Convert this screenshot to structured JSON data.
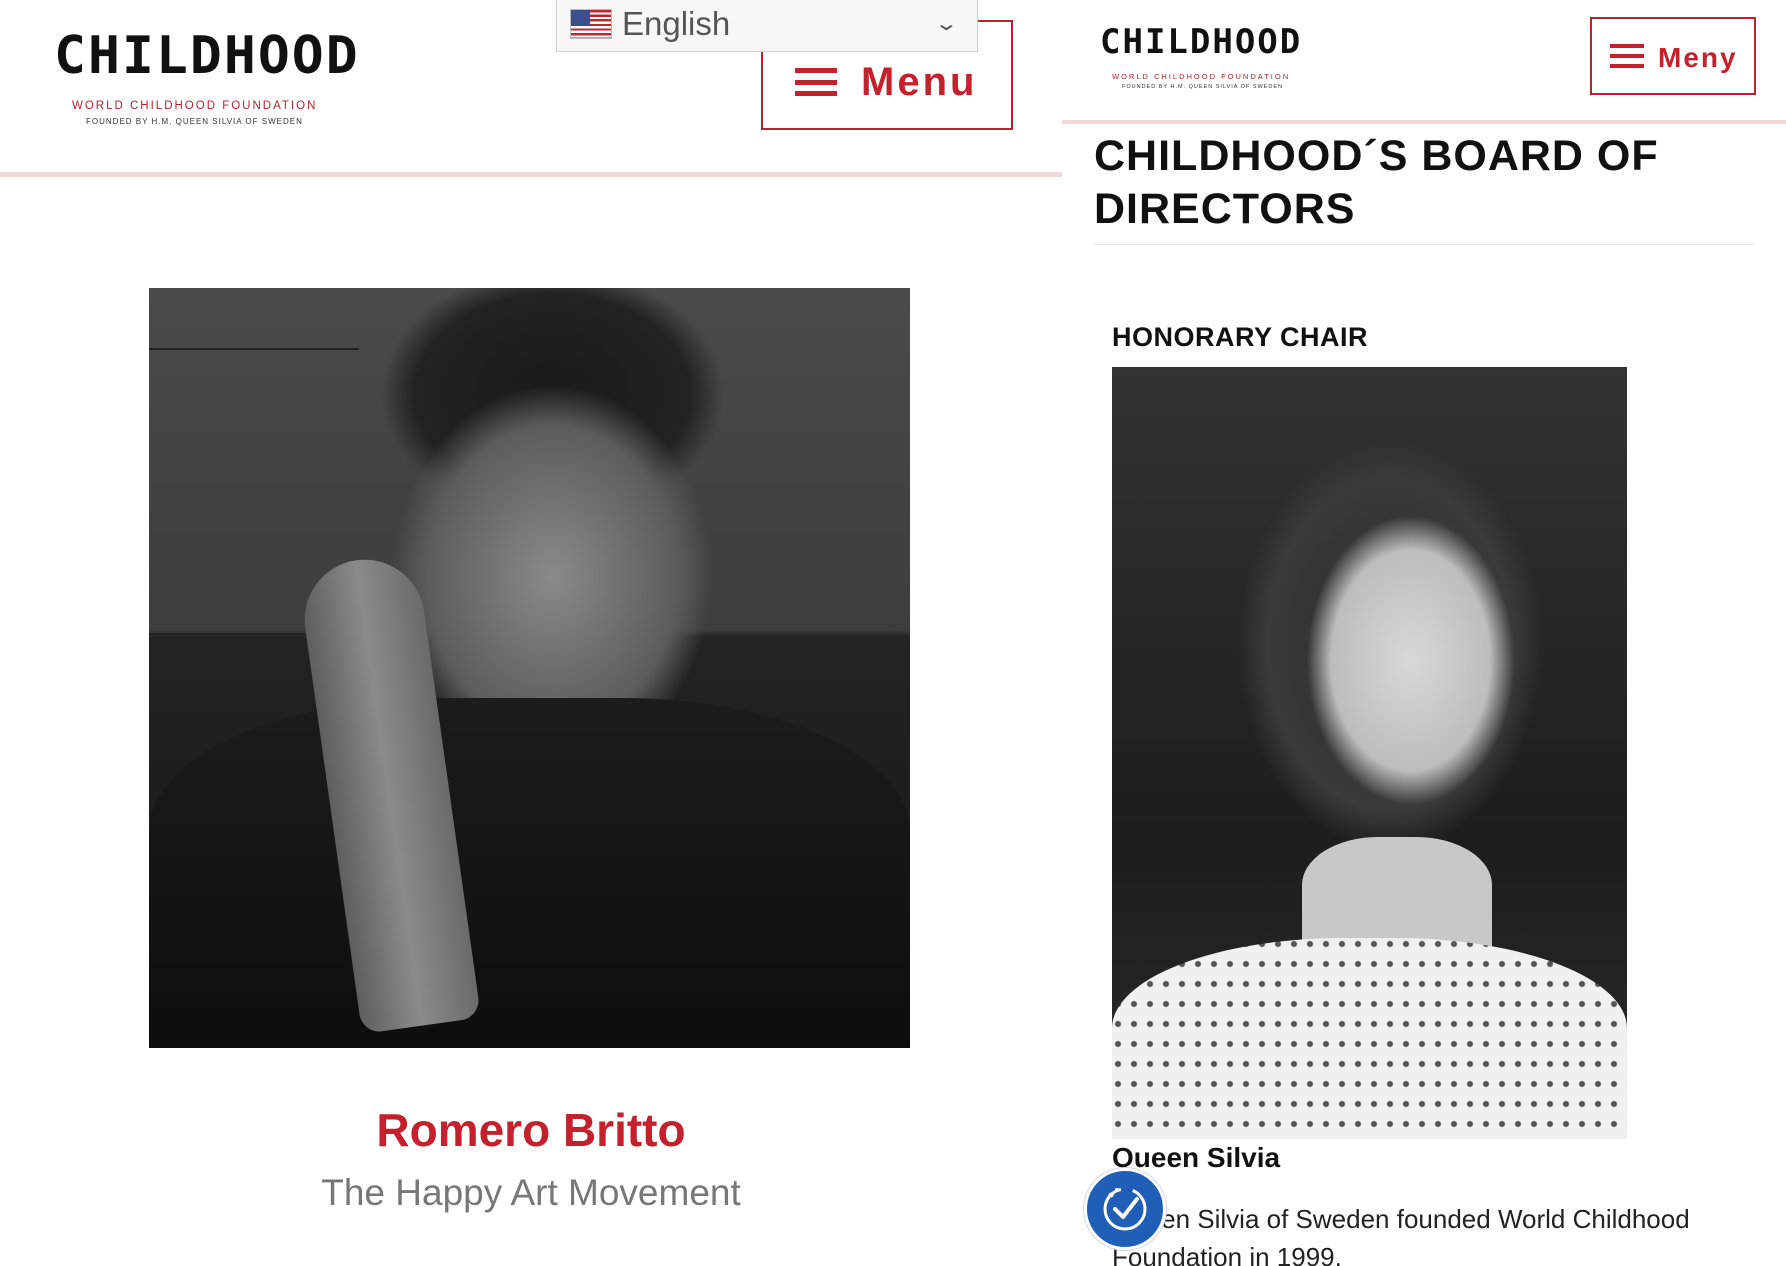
{
  "left_panel": {
    "logo": {
      "wordmark": "CHILDHOOD",
      "line1": "WORLD CHILDHOOD FOUNDATION",
      "line2": "FOUNDED BY H.M. QUEEN SILVIA OF SWEDEN"
    },
    "language_selector": {
      "flag_icon": "us-flag-icon",
      "selected": "English",
      "chevron_icon": "chevron-down-icon"
    },
    "menu_button": {
      "icon": "hamburger-icon",
      "label": "Menu"
    },
    "profile": {
      "name": "Romero Britto",
      "role": "The Happy Art Movement"
    }
  },
  "right_panel": {
    "logo": {
      "wordmark": "CHILDHOOD",
      "line1": "WORLD CHILDHOOD FOUNDATION",
      "line2": "FOUNDED BY H.M. QUEEN SILVIA OF SWEDEN"
    },
    "menu_button": {
      "icon": "hamburger-icon",
      "label": "Meny"
    },
    "page_title": "CHILDHOOD´S BOARD OF DIRECTORS",
    "section_label": "HONORARY CHAIR",
    "person_name": "Queen Silvia",
    "bio": "Queen Silvia of Sweden founded World Childhood Foundation in 1999.",
    "accessibility_icon": "accessibility-check-icon"
  },
  "colors": {
    "brand_red": "#c4212c",
    "accessibility_blue": "#1f5fb8"
  }
}
